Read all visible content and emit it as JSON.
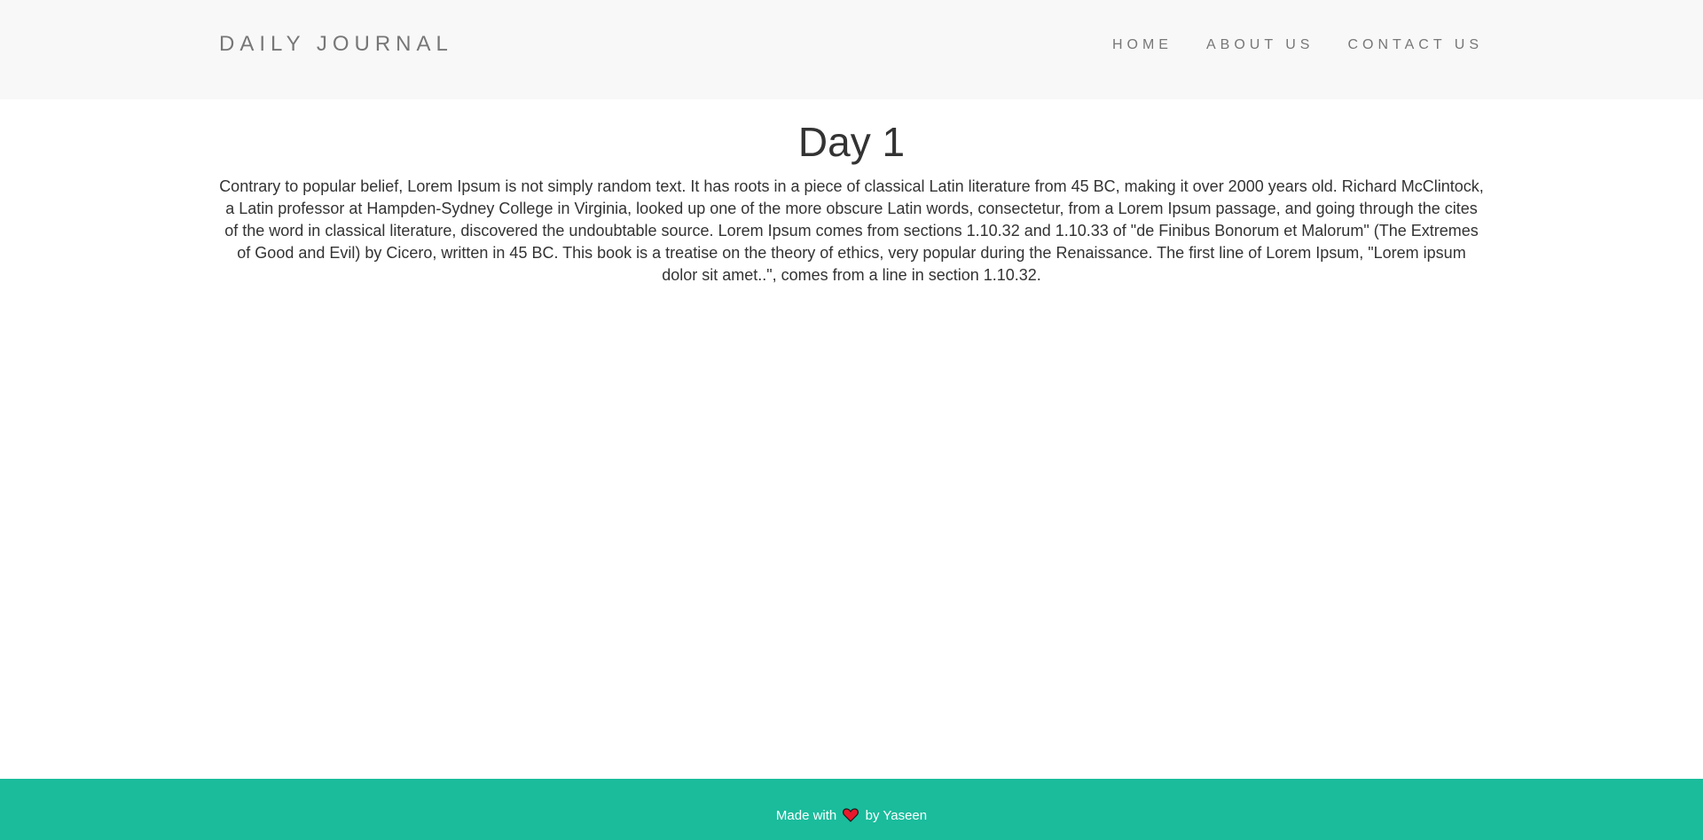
{
  "header": {
    "brand": "DAILY JOURNAL",
    "nav": [
      {
        "label": "HOME"
      },
      {
        "label": "ABOUT US"
      },
      {
        "label": "CONTACT US"
      }
    ]
  },
  "post": {
    "title": "Day 1",
    "body": "Contrary to popular belief, Lorem Ipsum is not simply random text. It has roots in a piece of classical Latin literature from 45 BC, making it over 2000 years old. Richard McClintock, a Latin professor at Hampden-Sydney College in Virginia, looked up one of the more obscure Latin words, consectetur, from a Lorem Ipsum passage, and going through the cites of the word in classical literature, discovered the undoubtable source. Lorem Ipsum comes from sections 1.10.32 and 1.10.33 of \"de Finibus Bonorum et Malorum\" (The Extremes of Good and Evil) by Cicero, written in 45 BC. This book is a treatise on the theory of ethics, very popular during the Renaissance. The first line of Lorem Ipsum, \"Lorem ipsum dolor sit amet..\", comes from a line in section 1.10.32."
  },
  "footer": {
    "prefix": "Made with",
    "icon": "heart-icon",
    "suffix": "by Yaseen"
  },
  "colors": {
    "navbar_bg": "#f8f8f8",
    "nav_text": "#777777",
    "footer_bg": "#1abc9c",
    "heart": "#e8192c"
  }
}
